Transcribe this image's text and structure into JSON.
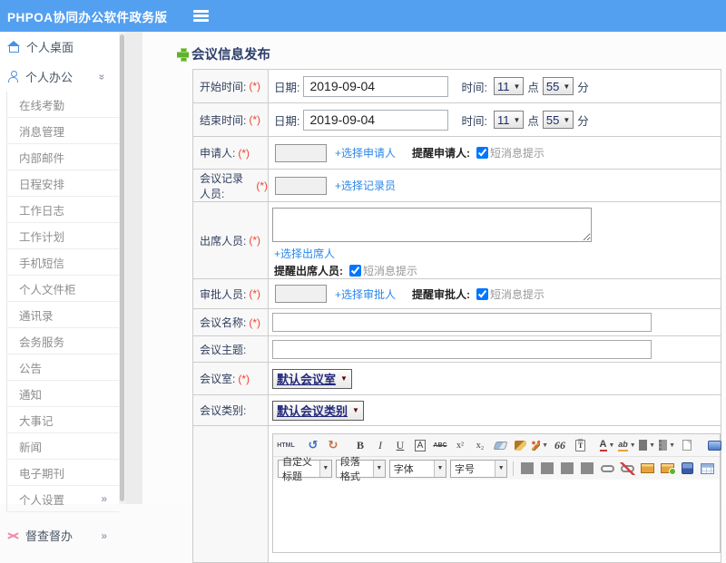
{
  "colors": {
    "header_bg": "#54a0f0",
    "link_blue": "#2b87e9",
    "required_red": "#f04330",
    "title_navy": "#2c3e6b",
    "sidebar_icon_blue": "#4a90e2",
    "shuffle_pink": "#f08aa8",
    "plus_green": "#5fb32c"
  },
  "header": {
    "logo": "PHPOA协同办公软件政务版"
  },
  "sidebar": {
    "items": [
      {
        "label": "个人桌面",
        "type": "top",
        "icon": "home-icon"
      },
      {
        "label": "个人办公",
        "type": "top",
        "icon": "user-icon",
        "chevron": "down"
      },
      {
        "label": "在线考勤",
        "type": "sub"
      },
      {
        "label": "消息管理",
        "type": "sub"
      },
      {
        "label": "内部邮件",
        "type": "sub"
      },
      {
        "label": "日程安排",
        "type": "sub"
      },
      {
        "label": "工作日志",
        "type": "sub"
      },
      {
        "label": "工作计划",
        "type": "sub"
      },
      {
        "label": "手机短信",
        "type": "sub"
      },
      {
        "label": "个人文件柜",
        "type": "sub"
      },
      {
        "label": "通讯录",
        "type": "sub"
      },
      {
        "label": "会务服务",
        "type": "sub"
      },
      {
        "label": "公告",
        "type": "sub"
      },
      {
        "label": "通知",
        "type": "sub"
      },
      {
        "label": "大事记",
        "type": "sub"
      },
      {
        "label": "新闻",
        "type": "sub"
      },
      {
        "label": "电子期刊",
        "type": "sub"
      },
      {
        "label": "个人设置",
        "type": "sub",
        "chevron": "right"
      },
      {
        "label": "督查督办",
        "type": "top",
        "icon": "shuffle-icon",
        "chevron": "right",
        "gap": true
      }
    ]
  },
  "form": {
    "title": "会议信息发布",
    "start_time": {
      "label": "开始时间:",
      "required": "(*)",
      "date_label": "日期:",
      "date_value": "2019-09-04",
      "time_label": "时间:",
      "hour": "11",
      "hour_suffix": "点",
      "minute": "55",
      "minute_suffix": "分"
    },
    "end_time": {
      "label": "结束时间:",
      "required": "(*)",
      "date_label": "日期:",
      "date_value": "2019-09-04",
      "time_label": "时间:",
      "hour": "11",
      "hour_suffix": "点",
      "minute": "55",
      "minute_suffix": "分"
    },
    "applicant": {
      "label": "申请人:",
      "required": "(*)",
      "link": "+选择申请人",
      "remind_label": "提醒申请人:",
      "sms_label": "短消息提示"
    },
    "recorder": {
      "label": "会议记录人员:",
      "required": "(*)",
      "link": "+选择记录员"
    },
    "attendees": {
      "label": "出席人员:",
      "required": "(*)",
      "link": "+选择出席人",
      "remind_label": "提醒出席人员:",
      "sms_label": "短消息提示"
    },
    "approver": {
      "label": "审批人员:",
      "required": "(*)",
      "link": "+选择审批人",
      "remind_label": "提醒审批人:",
      "sms_label": "短消息提示"
    },
    "meeting_name": {
      "label": "会议名称:",
      "required": "(*)"
    },
    "meeting_topic": {
      "label": "会议主题:"
    },
    "meeting_room": {
      "label": "会议室:",
      "required": "(*)",
      "value": "默认会议室"
    },
    "meeting_type": {
      "label": "会议类别:",
      "value": "默认会议类别"
    }
  },
  "editor": {
    "toolbar_row1": [
      {
        "name": "source-code",
        "kind": "text",
        "glyph": "HTML",
        "cls": "g-html"
      },
      {
        "name": "sep"
      },
      {
        "name": "undo",
        "kind": "text",
        "glyph": "↺",
        "cls": "g-undo"
      },
      {
        "name": "redo",
        "kind": "text",
        "glyph": "↻",
        "cls": "g-redo"
      },
      {
        "name": "sep"
      },
      {
        "name": "bold",
        "kind": "text",
        "glyph": "B",
        "cls": "g-bold"
      },
      {
        "name": "italic",
        "kind": "text",
        "glyph": "I",
        "cls": "g-italic"
      },
      {
        "name": "underline",
        "kind": "text",
        "glyph": "U",
        "cls": "g-underline"
      },
      {
        "name": "font-box",
        "kind": "text",
        "glyph": "A",
        "cls": "g-abox"
      },
      {
        "name": "strikethrough",
        "kind": "text",
        "glyph": "ABC",
        "cls": "g-strike"
      },
      {
        "name": "superscript",
        "kind": "text",
        "glyph": "x²",
        "cls": "g-sup"
      },
      {
        "name": "subscript",
        "kind": "text",
        "glyph": "x₂",
        "cls": "g-sub"
      },
      {
        "name": "eraser",
        "kind": "shape"
      },
      {
        "name": "format-clear",
        "kind": "shape"
      },
      {
        "name": "format-brush",
        "kind": "shape",
        "arrow": true
      },
      {
        "name": "blockquote",
        "kind": "text",
        "glyph": "66",
        "cls": "g-quote"
      },
      {
        "name": "paste",
        "kind": "shape"
      },
      {
        "name": "sep"
      },
      {
        "name": "font-color",
        "kind": "text",
        "glyph": "A",
        "cls": "g-fontcolor",
        "arrow": true
      },
      {
        "name": "highlight",
        "kind": "text",
        "glyph": "ab",
        "cls": "g-highlight",
        "arrow": true
      },
      {
        "name": "ordered-list",
        "kind": "shape",
        "arrow": true
      },
      {
        "name": "unordered-list",
        "kind": "shape",
        "arrow": true
      },
      {
        "name": "new-page",
        "kind": "shape"
      },
      {
        "name": "sep"
      },
      {
        "name": "fullscreen",
        "kind": "shape"
      }
    ],
    "toolbar_row2_selects": [
      {
        "name": "heading-select",
        "label": "自定义标题"
      },
      {
        "name": "paragraph-select",
        "label": "段落格式"
      },
      {
        "name": "font-family-select",
        "label": "字体"
      },
      {
        "name": "font-size-select",
        "label": "字号"
      }
    ],
    "toolbar_row2_icons": [
      {
        "name": "sep"
      },
      {
        "name": "align-left",
        "kind": "shape"
      },
      {
        "name": "align-center",
        "kind": "shape"
      },
      {
        "name": "align-right",
        "kind": "shape"
      },
      {
        "name": "justify",
        "kind": "shape"
      },
      {
        "name": "link",
        "kind": "shape"
      },
      {
        "name": "unlink",
        "kind": "shape"
      },
      {
        "name": "image",
        "kind": "shape"
      },
      {
        "name": "image-upload",
        "kind": "shape"
      },
      {
        "name": "media",
        "kind": "shape"
      },
      {
        "name": "table",
        "kind": "shape"
      }
    ]
  }
}
